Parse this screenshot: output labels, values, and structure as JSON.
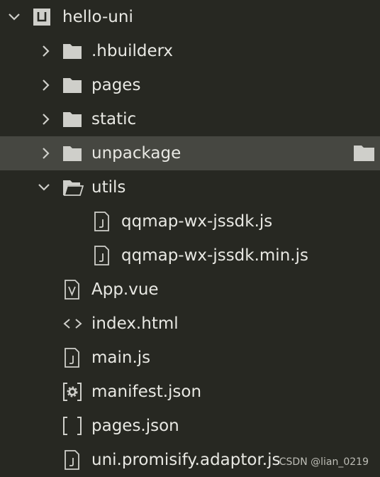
{
  "tree": {
    "project": {
      "label": "hello-uni",
      "icon": "project-icon"
    },
    "items": [
      {
        "label": ".hbuilderx",
        "icon": "folder-icon"
      },
      {
        "label": "pages",
        "icon": "folder-icon"
      },
      {
        "label": "static",
        "icon": "folder-icon"
      },
      {
        "label": "unpackage",
        "icon": "folder-icon"
      },
      {
        "label": "utils",
        "icon": "folder-open-icon"
      },
      {
        "label": "qqmap-wx-jssdk.js",
        "icon": "js-file-icon"
      },
      {
        "label": "qqmap-wx-jssdk.min.js",
        "icon": "js-file-icon"
      },
      {
        "label": "App.vue",
        "icon": "vue-file-icon"
      },
      {
        "label": "index.html",
        "icon": "html-file-icon"
      },
      {
        "label": "main.js",
        "icon": "js-file-icon"
      },
      {
        "label": "manifest.json",
        "icon": "manifest-file-icon"
      },
      {
        "label": "pages.json",
        "icon": "json-file-icon"
      },
      {
        "label": "uni.promisify.adaptor.js",
        "icon": "js-file-icon"
      }
    ]
  },
  "watermark": "CSDN @lian_0219",
  "colors": {
    "background": "#272822",
    "hover_row": "#464741",
    "text": "#e8e8e3",
    "icon": "#cfcfca"
  }
}
